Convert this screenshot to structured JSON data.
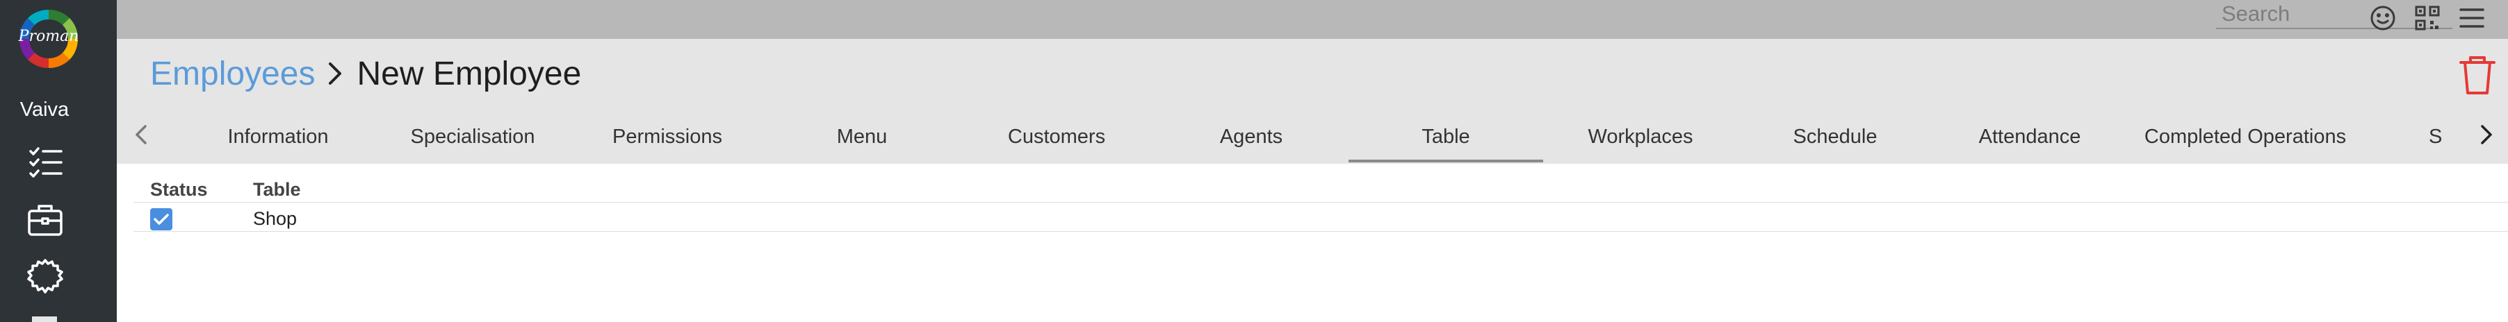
{
  "app": {
    "logo_text": "Proman",
    "user_name": "Vaiva"
  },
  "sidebar": {
    "items": [
      {
        "icon": "checklist-icon"
      },
      {
        "icon": "briefcase-icon"
      },
      {
        "icon": "gear-icon"
      }
    ]
  },
  "topbar": {
    "search_placeholder": "Search",
    "icons": [
      "smiley-icon",
      "qr-code-icon",
      "menu-icon"
    ]
  },
  "breadcrumb": {
    "parent": "Employees",
    "current": "New Employee"
  },
  "tabs": [
    {
      "label": "Information"
    },
    {
      "label": "Specialisation"
    },
    {
      "label": "Permissions"
    },
    {
      "label": "Menu"
    },
    {
      "label": "Customers"
    },
    {
      "label": "Agents"
    },
    {
      "label": "Table",
      "active": true
    },
    {
      "label": "Workplaces"
    },
    {
      "label": "Schedule"
    },
    {
      "label": "Attendance"
    },
    {
      "label": "Completed Operations"
    },
    {
      "label": "S"
    }
  ],
  "table": {
    "columns": [
      "Status",
      "Table"
    ],
    "rows": [
      {
        "status_checked": true,
        "table": "Shop"
      }
    ]
  },
  "colors": {
    "accent": "#5b9bd9",
    "rail": "#2e3338",
    "delete": "#e53935",
    "checkbox": "#4a8ee0"
  }
}
